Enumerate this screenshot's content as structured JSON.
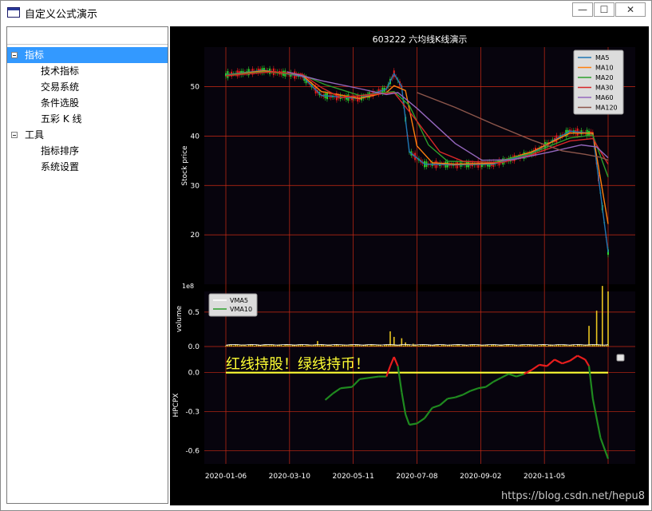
{
  "window": {
    "title": "自定义公式演示",
    "controls": {
      "minimize": "—",
      "maximize": "☐",
      "close": "✕"
    }
  },
  "tree": {
    "items": [
      {
        "label": "指标",
        "level": 0,
        "expanded": true,
        "selected": true
      },
      {
        "label": "技术指标",
        "level": 1
      },
      {
        "label": "交易系统",
        "level": 1
      },
      {
        "label": "条件选股",
        "level": 1
      },
      {
        "label": "五彩 K 线",
        "level": 1
      },
      {
        "label": "工具",
        "level": 0,
        "expanded": true,
        "selected": false
      },
      {
        "label": "指标排序",
        "level": 1
      },
      {
        "label": "系统设置",
        "level": 1
      }
    ]
  },
  "watermark": "https://blog.csdn.net/hepu8",
  "colors": {
    "plot_bg": "#07040d",
    "grid": "#cc2a14",
    "text": "#ffffff",
    "up": "#e81d1d",
    "down": "#2ed12e",
    "highlight": "#ffff33"
  },
  "chart_data": [
    {
      "type": "line",
      "title": "603222  六均线K线演示",
      "ylabel": "Stock price",
      "ylim": [
        10,
        58
      ],
      "yticks": [
        20,
        30,
        40,
        50
      ],
      "xticks": [
        "2020-01-06",
        "2020-03-10",
        "2020-05-11",
        "2020-07-08",
        "2020-09-02",
        "2020-11-05"
      ],
      "legend": "top-right",
      "grid": true,
      "series": [
        {
          "name": "MA5",
          "color": "#1f77b4",
          "values": [
            [
              0,
              52.4
            ],
            [
              0.1,
              53.3
            ],
            [
              0.2,
              52.1
            ],
            [
              0.25,
              48.2
            ],
            [
              0.35,
              47.6
            ],
            [
              0.42,
              49.5
            ],
            [
              0.44,
              52.6
            ],
            [
              0.46,
              50.0
            ],
            [
              0.48,
              36.8
            ],
            [
              0.52,
              34.3
            ],
            [
              0.6,
              34.2
            ],
            [
              0.7,
              34.3
            ],
            [
              0.8,
              36.5
            ],
            [
              0.9,
              41.0
            ],
            [
              0.96,
              40.5
            ],
            [
              1.0,
              16.5
            ]
          ]
        },
        {
          "name": "MA10",
          "color": "#ff7f0e",
          "values": [
            [
              0,
              52.3
            ],
            [
              0.1,
              53.2
            ],
            [
              0.2,
              52.3
            ],
            [
              0.25,
              49.0
            ],
            [
              0.35,
              47.6
            ],
            [
              0.42,
              48.8
            ],
            [
              0.44,
              50.2
            ],
            [
              0.47,
              49.2
            ],
            [
              0.5,
              38.0
            ],
            [
              0.54,
              34.6
            ],
            [
              0.6,
              34.3
            ],
            [
              0.7,
              34.5
            ],
            [
              0.8,
              36.8
            ],
            [
              0.9,
              40.6
            ],
            [
              0.96,
              40.6
            ],
            [
              1.0,
              22.2
            ]
          ]
        },
        {
          "name": "MA20",
          "color": "#2ca02c",
          "values": [
            [
              0,
              52.3
            ],
            [
              0.1,
              53.0
            ],
            [
              0.2,
              52.4
            ],
            [
              0.26,
              50.4
            ],
            [
              0.35,
              48.2
            ],
            [
              0.44,
              49.0
            ],
            [
              0.48,
              46.2
            ],
            [
              0.53,
              38.2
            ],
            [
              0.58,
              34.9
            ],
            [
              0.7,
              34.7
            ],
            [
              0.8,
              36.5
            ],
            [
              0.9,
              39.6
            ],
            [
              0.96,
              40.2
            ],
            [
              1.0,
              31.7
            ]
          ]
        },
        {
          "name": "MA30",
          "color": "#d62728",
          "values": [
            [
              0,
              52.2
            ],
            [
              0.12,
              53.0
            ],
            [
              0.2,
              52.5
            ],
            [
              0.25,
              49.8
            ],
            [
              0.3,
              47.8
            ],
            [
              0.44,
              48.8
            ],
            [
              0.5,
              43.0
            ],
            [
              0.56,
              36.8
            ],
            [
              0.62,
              34.9
            ],
            [
              0.72,
              34.6
            ],
            [
              0.8,
              36.2
            ],
            [
              0.9,
              39.0
            ],
            [
              0.96,
              39.5
            ],
            [
              1.0,
              34.3
            ]
          ]
        },
        {
          "name": "MA60",
          "color": "#9467bd",
          "values": [
            [
              0.16,
              53.0
            ],
            [
              0.25,
              51.2
            ],
            [
              0.35,
              49.6
            ],
            [
              0.42,
              48.4
            ],
            [
              0.45,
              48.8
            ],
            [
              0.5,
              45.6
            ],
            [
              0.6,
              38.5
            ],
            [
              0.67,
              35.1
            ],
            [
              0.75,
              35.2
            ],
            [
              0.85,
              36.8
            ],
            [
              0.93,
              38.2
            ],
            [
              0.97,
              37.8
            ],
            [
              1.0,
              35.6
            ]
          ]
        },
        {
          "name": "MA120",
          "color": "#8c564b",
          "values": [
            [
              0.5,
              48.8
            ],
            [
              0.6,
              45.8
            ],
            [
              0.7,
              42.4
            ],
            [
              0.8,
              39.2
            ],
            [
              0.88,
              37.0
            ],
            [
              0.94,
              36.3
            ],
            [
              0.98,
              35.7
            ],
            [
              1.0,
              35.1
            ]
          ]
        }
      ]
    },
    {
      "type": "bar",
      "ylabel": "volume",
      "scale_label": "1e8",
      "ylim": [
        0,
        0.8
      ],
      "yticks": [
        "0.0",
        "0.5"
      ],
      "legend": "top-left",
      "series": [
        {
          "name": "VMA5",
          "color": "#ffffff"
        },
        {
          "name": "VMA10",
          "color": "#2ca02c"
        }
      ],
      "spikes": [
        [
          0.24,
          0.08
        ],
        [
          0.43,
          0.22
        ],
        [
          0.44,
          0.14
        ],
        [
          0.46,
          0.12
        ],
        [
          0.47,
          0.06
        ],
        [
          0.49,
          0.04
        ],
        [
          0.95,
          0.3
        ],
        [
          0.97,
          0.52
        ],
        [
          0.985,
          0.88
        ],
        [
          1.0,
          0.8
        ]
      ]
    },
    {
      "type": "line",
      "ylabel": "HPCPX",
      "ylim": [
        -0.7,
        0.2
      ],
      "yticks": [
        "0.0",
        "-0.3",
        "-0.6"
      ],
      "annotation": "红线持股！绿线持币！",
      "zero_line_color": "#ffff33",
      "values": [
        [
          0.26,
          -0.21
        ],
        [
          0.28,
          -0.16
        ],
        [
          0.3,
          -0.12
        ],
        [
          0.33,
          -0.11
        ],
        [
          0.35,
          -0.05
        ],
        [
          0.4,
          -0.03
        ],
        [
          0.42,
          -0.03
        ],
        [
          0.43,
          0.05
        ],
        [
          0.44,
          0.12
        ],
        [
          0.45,
          0.05
        ],
        [
          0.46,
          -0.15
        ],
        [
          0.47,
          -0.32
        ],
        [
          0.48,
          -0.4
        ],
        [
          0.5,
          -0.39
        ],
        [
          0.52,
          -0.35
        ],
        [
          0.54,
          -0.27
        ],
        [
          0.56,
          -0.25
        ],
        [
          0.58,
          -0.2
        ],
        [
          0.6,
          -0.19
        ],
        [
          0.62,
          -0.17
        ],
        [
          0.64,
          -0.14
        ],
        [
          0.66,
          -0.12
        ],
        [
          0.68,
          -0.11
        ],
        [
          0.7,
          -0.07
        ],
        [
          0.72,
          -0.04
        ],
        [
          0.74,
          -0.01
        ],
        [
          0.76,
          -0.03
        ],
        [
          0.78,
          -0.01
        ],
        [
          0.8,
          0.02
        ],
        [
          0.82,
          0.06
        ],
        [
          0.84,
          0.05
        ],
        [
          0.86,
          0.1
        ],
        [
          0.88,
          0.07
        ],
        [
          0.9,
          0.09
        ],
        [
          0.92,
          0.13
        ],
        [
          0.94,
          0.1
        ],
        [
          0.95,
          0.05
        ],
        [
          0.96,
          -0.2
        ],
        [
          0.98,
          -0.5
        ],
        [
          1.0,
          -0.66
        ]
      ]
    }
  ]
}
